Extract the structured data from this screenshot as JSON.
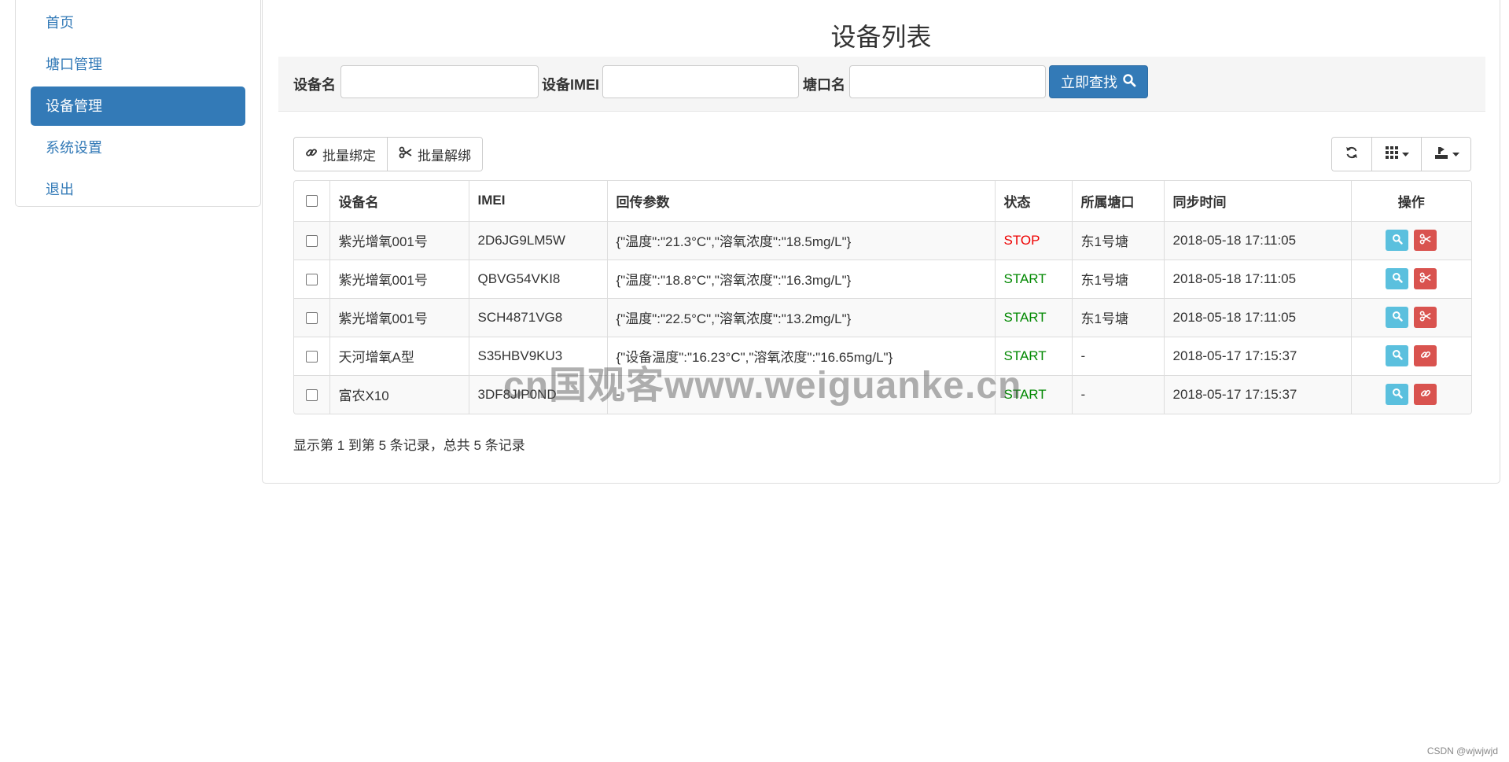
{
  "sidebar": {
    "items": [
      {
        "label": "首页",
        "active": false
      },
      {
        "label": "塘口管理",
        "active": false
      },
      {
        "label": "设备管理",
        "active": true
      },
      {
        "label": "系统设置",
        "active": false
      },
      {
        "label": "退出",
        "active": false
      }
    ]
  },
  "page": {
    "title": "设备列表"
  },
  "search": {
    "device_name_label": "设备名",
    "device_name_value": "",
    "imei_label": "设备IMEI",
    "imei_value": "",
    "pond_label": "塘口名",
    "pond_value": "",
    "submit_label": "立即查找"
  },
  "toolbar": {
    "bind_label": "批量绑定",
    "unbind_label": "批量解绑",
    "refresh_icon": "refresh-icon",
    "columns_icon": "grid-icon",
    "export_icon": "export-icon"
  },
  "table": {
    "headers": {
      "name": "设备名",
      "imei": "IMEI",
      "params": "回传参数",
      "status": "状态",
      "pond": "所属塘口",
      "sync": "同步时间",
      "ops": "操作"
    },
    "rows": [
      {
        "name": "紫光增氧001号",
        "imei": "2D6JG9LM5W",
        "params": "{\"温度\":\"21.3°C\",\"溶氧浓度\":\"18.5mg/L\"}",
        "status": "STOP",
        "pond": "东1号塘",
        "sync": "2018-05-18 17:11:05",
        "action": "unbind"
      },
      {
        "name": "紫光增氧001号",
        "imei": "QBVG54VKI8",
        "params": "{\"温度\":\"18.8°C\",\"溶氧浓度\":\"16.3mg/L\"}",
        "status": "START",
        "pond": "东1号塘",
        "sync": "2018-05-18 17:11:05",
        "action": "unbind"
      },
      {
        "name": "紫光增氧001号",
        "imei": "SCH4871VG8",
        "params": "{\"温度\":\"22.5°C\",\"溶氧浓度\":\"13.2mg/L\"}",
        "status": "START",
        "pond": "东1号塘",
        "sync": "2018-05-18 17:11:05",
        "action": "unbind"
      },
      {
        "name": "天河增氧A型",
        "imei": "S35HBV9KU3",
        "params": "{\"设备温度\":\"16.23°C\",\"溶氧浓度\":\"16.65mg/L\"}",
        "status": "START",
        "pond": "-",
        "sync": "2018-05-17 17:15:37",
        "action": "bind"
      },
      {
        "name": "富农X10",
        "imei": "3DF8JIP0ND",
        "params": "-",
        "status": "START",
        "pond": "-",
        "sync": "2018-05-17 17:15:37",
        "action": "bind"
      }
    ]
  },
  "pagination": {
    "summary": "显示第 1 到第 5 条记录，总共 5 条记录"
  },
  "watermark": "cn国观客www.weiguanke.cn",
  "credit": "CSDN @wjwjwjd",
  "colors": {
    "primary": "#337ab7",
    "info": "#5bc0de",
    "danger": "#d9534f",
    "stop": "#e00000",
    "start": "#008000"
  }
}
